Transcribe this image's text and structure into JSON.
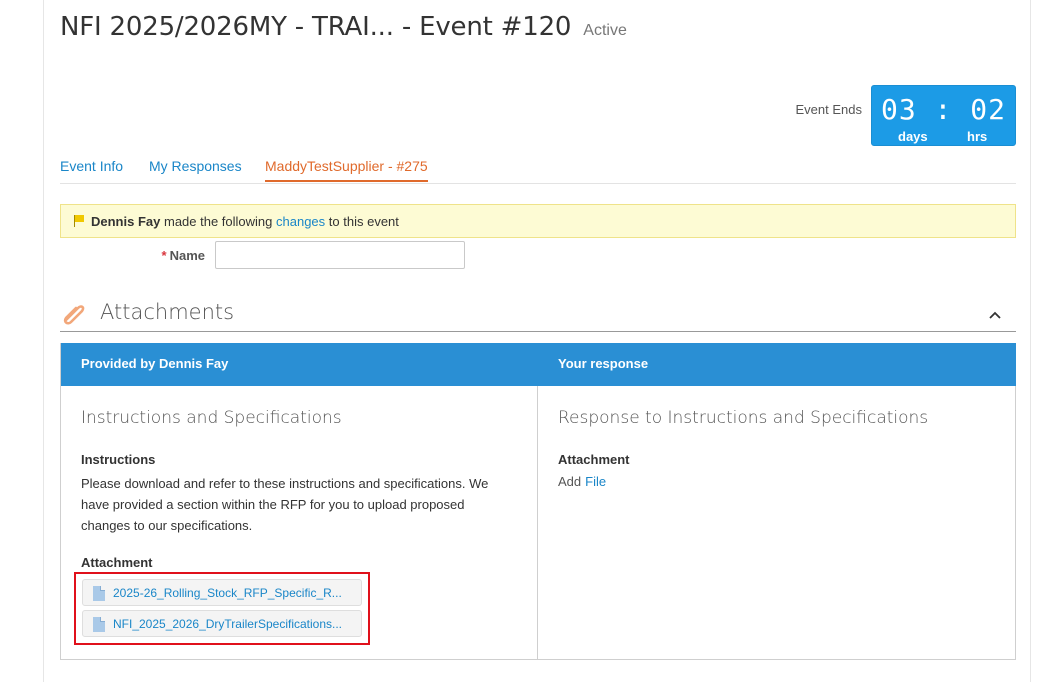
{
  "header": {
    "title": "NFI 2025/2026MY - TRAI... - Event #120",
    "status": "Active"
  },
  "timer": {
    "label": "Event Ends",
    "display": "03 : 02",
    "days_label": "days",
    "hrs_label": "hrs",
    "color": "#1c9be6"
  },
  "tabs": [
    {
      "label": "Event Info",
      "active": false
    },
    {
      "label": "My Responses",
      "active": false
    },
    {
      "label": "MaddyTestSupplier - #275",
      "active": true
    }
  ],
  "notice": {
    "user": "Dennis Fay",
    "text_before": "made the following",
    "link": "changes",
    "text_after": "to this event",
    "icon": "flag-icon"
  },
  "form": {
    "name_required_mark": "*",
    "name_label": "Name",
    "name_value": "",
    "name_placeholder": ""
  },
  "section": {
    "title": "Attachments",
    "icon": "paperclip-icon",
    "collapse_icon": "chevron-up-icon"
  },
  "table": {
    "headers": [
      "Provided by Dennis Fay",
      "Your response"
    ],
    "header_color": "#2a8fd4",
    "left": {
      "title": "Instructions and Specifications",
      "instructions_label": "Instructions",
      "instructions_text": "Please download and refer to these instructions and specifications. We have provided a section within the RFP for you to upload proposed changes to our specifications.",
      "attachment_label": "Attachment",
      "files": [
        "2025-26_Rolling_Stock_RFP_Specific_R...",
        "NFI_2025_2026_DryTrailerSpecifications..."
      ]
    },
    "right": {
      "title": "Response to Instructions and Specifications",
      "attachment_label": "Attachment",
      "add_text": "Add",
      "file_link": "File"
    }
  }
}
